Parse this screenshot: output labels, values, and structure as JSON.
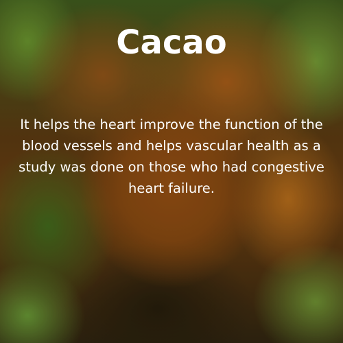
{
  "card": {
    "title": "Cacao",
    "body": "It helps the heart improve the function of the blood vessels and helps vascular health as a study was done on those who had congestive heart failure."
  },
  "colors": {
    "text": "#ffffff",
    "background_dominant": "#8a5218",
    "foliage": "#6a9a30"
  }
}
